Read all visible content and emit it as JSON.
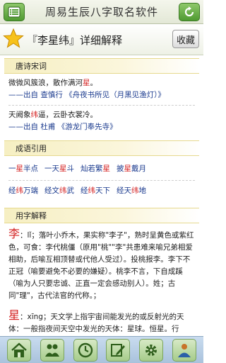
{
  "app": {
    "title": "周易生辰八字取名软件"
  },
  "header": {
    "title": "『李星纬』详细解释",
    "favorite_label": "收藏"
  },
  "sections": {
    "poetry": {
      "title": "唐诗宋词",
      "items": [
        {
          "line_pre": "微微风簇浪，散作满河",
          "line_hl": "星",
          "line_post": "。",
          "src": "——出自 查慎行 《舟夜书所见（月黑见渔灯）》"
        },
        {
          "line_pre": "天阙象",
          "line_hl": "纬",
          "line_post": "逼，云卧衣裳冷。",
          "src": "——出自 杜甫 《游龙门奉先寺》"
        }
      ]
    },
    "idioms": {
      "title": "成语引用",
      "row1": [
        {
          "pre": "一",
          "hl": "星",
          "post": "半点"
        },
        {
          "pre": "一天",
          "hl": "星",
          "post": "斗"
        },
        {
          "pre": "灿若繁",
          "hl": "星",
          "post": ""
        },
        {
          "pre": "披",
          "hl": "星",
          "post": "戴月"
        }
      ],
      "row2": [
        {
          "pre": "经",
          "hl": "纬",
          "post": "万端"
        },
        {
          "pre": "经文",
          "hl": "纬",
          "post": "武"
        },
        {
          "pre": "经",
          "hl": "纬",
          "post": "天下"
        },
        {
          "pre": "经天",
          "hl": "纬",
          "post": "地"
        }
      ]
    },
    "chars": {
      "title": "用字解释",
      "entries": [
        {
          "char": "李",
          "text": "：lǐ；落叶小乔木，果实称\"李子\"，熟时呈黄色或紫红色，可食：李代桃僵（原用\"桃\"\"李\"共患难来喻兄弟相爱相助，后喻互相顶替或代他人受过）。投桃报李。李下不正冠（喻要避免不必要的嫌疑）。桃李不言，下自成蹊（喻为人只要忠诚、正直一定会感动别人）。姓；古同\"理\"，古代法官的代称。；"
        },
        {
          "char": "星",
          "text": "：xīng；天文学上指宇宙间能发光的或反射光的天体：一般指夜间天空中发光的天体：星球。恒星。行"
        }
      ]
    }
  },
  "tabbar": {
    "items": [
      {
        "name": "home-icon"
      },
      {
        "name": "people-icon"
      },
      {
        "name": "clock-icon"
      },
      {
        "name": "edit-icon"
      },
      {
        "name": "gear-icon"
      },
      {
        "name": "user-icon"
      }
    ]
  },
  "colors": {
    "accent": "#d42222",
    "link": "#1a3a8e",
    "toolbar_green": "#4f9a31"
  }
}
